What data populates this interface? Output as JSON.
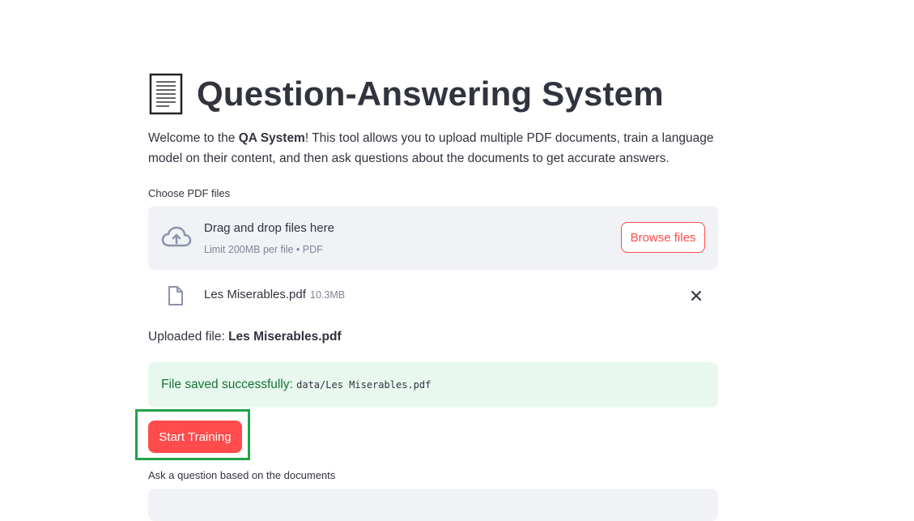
{
  "page": {
    "title": "Question-Answering System",
    "title_icon": "page-document-icon"
  },
  "intro": {
    "prefix": "Welcome to the ",
    "bold": "QA System",
    "suffix": "! This tool allows you to upload multiple PDF documents, train a language model on their content, and then ask questions about the documents to get accurate answers."
  },
  "uploader": {
    "label": "Choose PDF files",
    "drop_title": "Drag and drop files here",
    "drop_subtitle": "Limit 200MB per file • PDF",
    "browse_label": "Browse files",
    "icon": "cloud-upload-icon"
  },
  "uploaded_file": {
    "name": "Les Miserables.pdf",
    "size": "10.3MB",
    "icon": "file-icon",
    "remove_icon": "close-icon"
  },
  "status": {
    "uploaded_prefix": "Uploaded file: ",
    "uploaded_name": "Les Miserables.pdf",
    "success_prefix": "File saved successfully: ",
    "success_path": "data/Les Miserables.pdf"
  },
  "actions": {
    "train_label": "Start Training"
  },
  "question": {
    "label": "Ask a question based on the documents",
    "value": "",
    "placeholder": ""
  },
  "colors": {
    "accent": "#ff4b4b",
    "text": "#31333f",
    "muted": "#808495",
    "panel": "#f0f2f6",
    "success_bg": "#e8f8ee",
    "success_text": "#177233",
    "highlight": "#22a34a"
  }
}
